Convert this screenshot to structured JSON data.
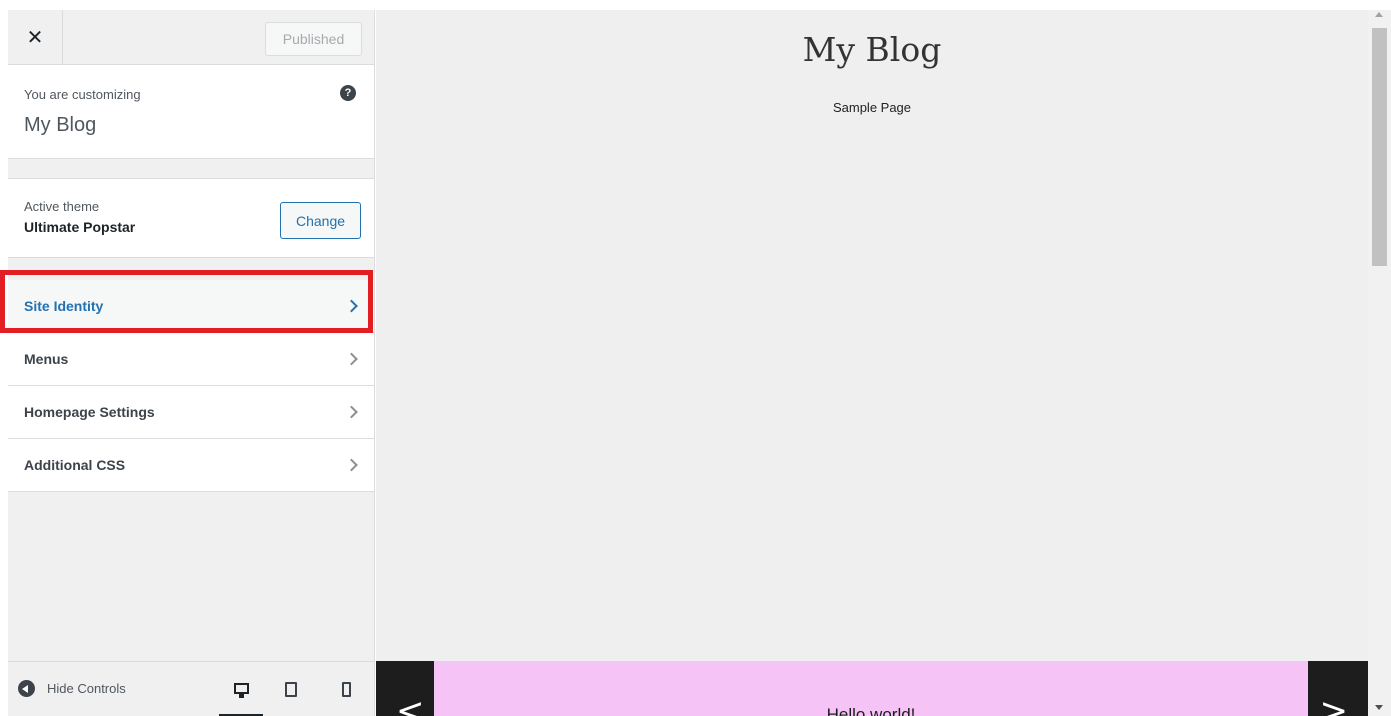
{
  "topbar": {
    "close_label": "✕",
    "published_label": "Published"
  },
  "customizing": {
    "label": "You are customizing",
    "site_name": "My Blog",
    "help_glyph": "?"
  },
  "theme": {
    "label": "Active theme",
    "name": "Ultimate Popstar",
    "change_label": "Change"
  },
  "menu": {
    "items": [
      {
        "label": "Site Identity",
        "active": true
      },
      {
        "label": "Menus",
        "active": false
      },
      {
        "label": "Homepage Settings",
        "active": false
      },
      {
        "label": "Additional CSS",
        "active": false
      }
    ]
  },
  "footer": {
    "hide_controls_label": "Hide Controls",
    "devices": [
      "desktop-icon",
      "tablet-icon",
      "mobile-icon"
    ],
    "active_device": "desktop"
  },
  "preview": {
    "site_title": "My Blog",
    "nav_link": "Sample Page",
    "slide_title": "Hello world!",
    "prev_glyph": "<",
    "next_glyph": ">"
  },
  "colors": {
    "accent": "#2271b1",
    "highlight": "#e21d24",
    "slide_bg": "#f5c3f6",
    "slider_dark": "#1d1d1d"
  }
}
